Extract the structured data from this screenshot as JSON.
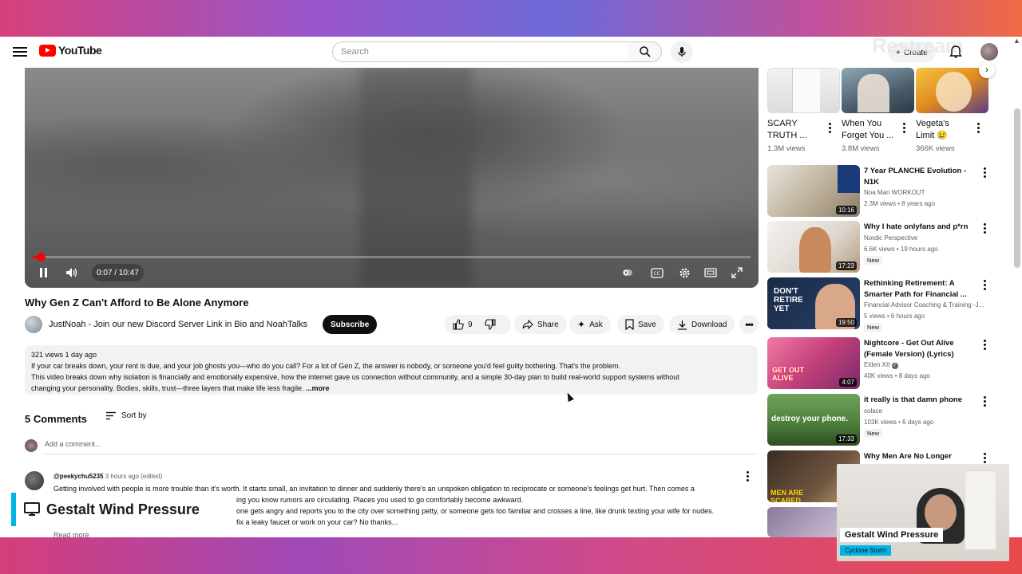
{
  "header": {
    "brand": "YouTube",
    "search_placeholder": "Search",
    "create_label": "Create",
    "watermark": "Restream"
  },
  "player": {
    "time": "0:07 / 10:47",
    "progress": 0.011
  },
  "video": {
    "title": "Why Gen Z Can't Afford to Be Alone Anymore",
    "channel": "JustNoah - Join our new Discord Server Link in Bio and NoahTalks",
    "subscribe": "Subscribe",
    "likes": "9",
    "share": "Share",
    "ask": "Ask",
    "save": "Save",
    "download": "Download"
  },
  "description": {
    "meta": "321 views  1 day ago",
    "line1": "If your car breaks down, your rent is due, and your job ghosts you—who do you call? For a lot of Gen Z, the answer is nobody, or someone you'd feel guilty bothering. That's the problem.",
    "line2": "This video breaks down why isolation is financially and emotionally expensive, how the internet gave us connection without community, and a simple 30-day plan to build real-world support systems without",
    "line3": "changing your personality. Bodies, skills, trust—three layers that make life less fragile.",
    "more": "...more"
  },
  "comments": {
    "count": "5 Comments",
    "sort": "Sort by",
    "add_placeholder": "Add a comment...",
    "items": [
      {
        "author": "@peekychu5235",
        "time": "3 hours ago (edited)",
        "line1": "Getting involved with people is more trouble than it's worth. It starts small, an invitation to dinner and suddenly there's an unspoken obligation to reciprocate or someone's feelings get hurt. Then comes a",
        "line2": "ing you know rumors are circulating. Places you used to go comfortably become awkward.",
        "line3": "one gets angry and reports you to the city over something petty, or someone gets too familiar and crosses a line, like drunk texting your wife for nudes.",
        "line4": "fix a leaky faucet or work on your car? No thanks...",
        "more": "Read more"
      }
    ]
  },
  "shorts": [
    {
      "title1": "SCARY",
      "title2": "TRUTH ...",
      "views": "1.3M views"
    },
    {
      "title1": "When You",
      "title2": "Forget You ...",
      "views": "3.8M views"
    },
    {
      "title1": "Vegeta's",
      "title2": "Limit 😢",
      "views": "366K views"
    }
  ],
  "sidebar": [
    {
      "title1": "7 Year PLANCHE Evolution -",
      "title2": "N1K",
      "channel": "Noa Man WORKOUT",
      "stats": "2.3M views • 8 years ago",
      "duration": "10:16",
      "badge": ""
    },
    {
      "title1": "Why I hate onlyfans and p*rn",
      "title2": "",
      "channel": "Nordic Perspective",
      "stats": "6.6K views • 19 hours ago",
      "duration": "17:23",
      "badge": "New"
    },
    {
      "title1": "Rethinking Retirement: A",
      "title2": "Smarter Path for Financial ...",
      "channel": "Financial Advisor Coaching & Training -J...",
      "stats": "5 views • 6 hours ago",
      "duration": "19:50",
      "badge": "New",
      "thumb_text": "DON'T RETIRE YET"
    },
    {
      "title1": "Nightcore - Get Out Alive",
      "title2": "(Female Version) (Lyrics)",
      "channel": "Elden XII",
      "stats": "40K views • 8 days ago",
      "duration": "4:07",
      "badge": "",
      "thumb_text": "GET OUT ALIVE"
    },
    {
      "title1": "it really is that damn phone",
      "title2": "",
      "channel": "solace",
      "stats": "103K views • 6 days ago",
      "duration": "17:33",
      "badge": "New",
      "thumb_text": "destroy your phone."
    },
    {
      "title1": "Why Men Are No Longer",
      "title2": "",
      "channel": "",
      "stats": "",
      "duration": "",
      "badge": "",
      "thumb_text": "MEN ARE SCARED"
    }
  ],
  "overlay": {
    "lower_third": "Gestalt Wind Pressure",
    "cam_name": "Gestalt Wind Pressure",
    "cam_sub": "Cyclone Storm"
  }
}
